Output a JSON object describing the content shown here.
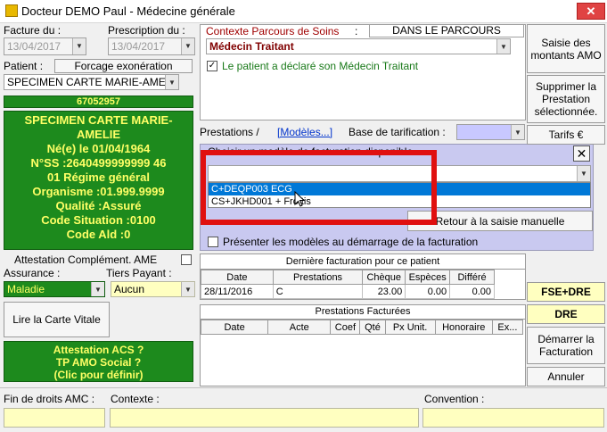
{
  "window": {
    "title": "Docteur DEMO Paul - Médecine générale",
    "close": "✕"
  },
  "left": {
    "facture_label": "Facture du :",
    "facture_date": "13/04/2017",
    "prescription_label": "Prescription du :",
    "prescription_date": "13/04/2017",
    "patient_label": "Patient :",
    "forcage_button": "Forcage exonération",
    "patient_select": "SPECIMEN CARTE MARIE-AMELIE",
    "patient_number": "67052957",
    "card": {
      "name": "SPECIMEN CARTE MARIE-AMELIE",
      "birth": "Né(e) le 01/04/1964",
      "nss": "N°SS :2640499999999 46",
      "regime": "01 Régime général",
      "organisme": "Organisme :01.999.9999",
      "qualite": "Qualité :Assuré",
      "code_situation": "Code Situation :0100",
      "code_ald": "Code Ald :0"
    },
    "attestation_label": "Attestation Complément. AME",
    "assurance_label": "Assurance :",
    "assurance_value": "Maladie",
    "tiers_payant_label": "Tiers Payant :",
    "tiers_payant_value": "Aucun",
    "lire_carte_button": "Lire la Carte Vitale",
    "acs_box": [
      "Attestation ACS ?",
      "TP AMO Social ?",
      "(Clic pour définir)"
    ]
  },
  "middle": {
    "contexte_label": "Contexte Parcours de Soins",
    "contexte_colon": ":",
    "parcours_status": "DANS LE PARCOURS",
    "medecin_select": "Médecin Traitant",
    "declare_text": "Le patient a déclaré son Médecin Traitant",
    "prestations_label": "Prestations /",
    "modeles_link": "[Modèles...]",
    "base_tarif_label": "Base de tarification :",
    "choose_model_label": "Choisir un modèle de facturation disponible",
    "model_options": [
      "C+DEQP003  ECG",
      "CS+JKHD001 + Frottis"
    ],
    "retour_button": "Retour à la saisie manuelle",
    "presenter_label": "Présenter les modèles au démarrage de la facturation",
    "derniere_title": "Dernière facturation pour ce patient",
    "derniere_cols": [
      "Date",
      "Prestations",
      "Chèque",
      "Espèces",
      "Différé"
    ],
    "derniere_row": [
      "28/11/2016",
      "C",
      "23.00",
      "0.00",
      "0.00"
    ],
    "facturees_title": "Prestations Facturées",
    "facturees_cols": [
      "Date",
      "Acte",
      "Coef",
      "Qté",
      "Px Unit.",
      "Honoraire",
      "Ex..."
    ]
  },
  "right": {
    "saisie_button": "Saisie des montants AMO",
    "supprimer_button": "Supprimer la Prestation sélectionnée.",
    "tarifs_button": "Tarifs €",
    "fse_button": "FSE+DRE",
    "dre_button": "DRE",
    "demarrer_button": "Démarrer la Facturation",
    "annuler_button": "Annuler"
  },
  "footer": {
    "fin_droits_label": "Fin de droits AMC :",
    "contexte_label": "Contexte :",
    "convention_label": "Convention :"
  },
  "colors": {
    "green": "#1d8a1d",
    "highlight": "#0078d7",
    "red_outline": "#e01010"
  }
}
